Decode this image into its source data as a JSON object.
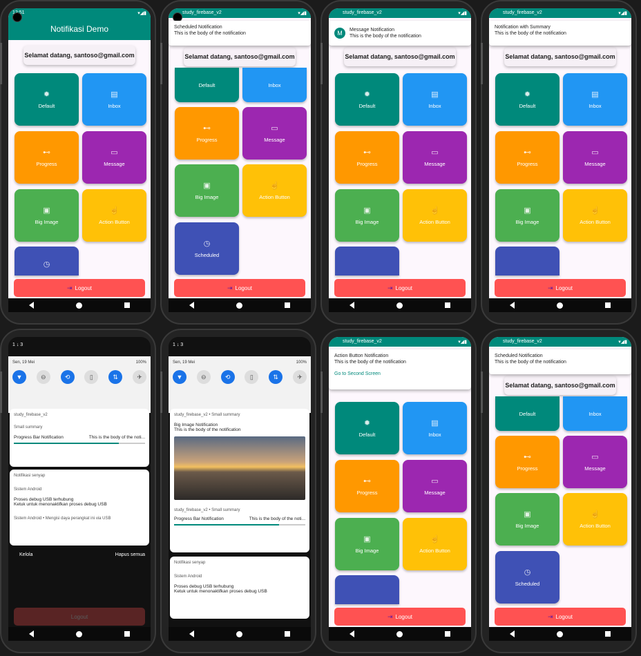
{
  "colors": {
    "accent": "#00897b",
    "logout": "#ff5252",
    "teal": "#00897b",
    "blue": "#2196f3",
    "orange": "#ff9800",
    "purple": "#9c27b0",
    "green": "#4caf50",
    "amber": "#ffc107",
    "indigo": "#3f51b5"
  },
  "app": {
    "title": "Notifikasi Demo",
    "welcome": "Selamat datang, santoso@gmail.com",
    "status_time": "12:51",
    "app_name": "study_firebase_v2"
  },
  "tiles": {
    "default": "Default",
    "inbox": "Inbox",
    "progress": "Progress",
    "message": "Message",
    "big_image": "Big Image",
    "action_button": "Action Button",
    "scheduled": "Scheduled"
  },
  "logout": "Logout",
  "notifications": {
    "scheduled": {
      "title": "Scheduled Notification",
      "body": "This is the body of the notification"
    },
    "message": {
      "title": "Message Notification",
      "body": "This is the body of the notification",
      "avatar": "M"
    },
    "summary": {
      "title": "Notification with Summary",
      "body": "This is the body of the notification"
    },
    "action": {
      "title": "Action Button Notification",
      "body": "This is the body of the notification",
      "action": "Go to Second Screen"
    }
  },
  "shade": {
    "time": "1 ↓ 3",
    "date": "Sen, 19 Mei",
    "battery": "100%",
    "app_line": "study_firebase_v2",
    "app_line_summary": "study_firebase_v2 • Small summary",
    "small_summary": "Small summary",
    "progress_title": "Progress Bar Notification",
    "progress_body": "This is the body of the noti...",
    "progress_body2": "This is the body of the noti...",
    "progress_value": 0.8,
    "silent": "Notifikasi senyap",
    "android": "Sistem Android",
    "usb_title": "Proses debug USB terhubung",
    "usb_body": "Ketuk untuk menonaktifkan proses debug USB",
    "charging": "Sistem Android • Mengisi daya perangkat ini via USB",
    "manage": "Kelola",
    "clear": "Hapus semua",
    "bigimg_title": "Big Image Notification",
    "bigimg_body": "This is the body of the notification"
  }
}
